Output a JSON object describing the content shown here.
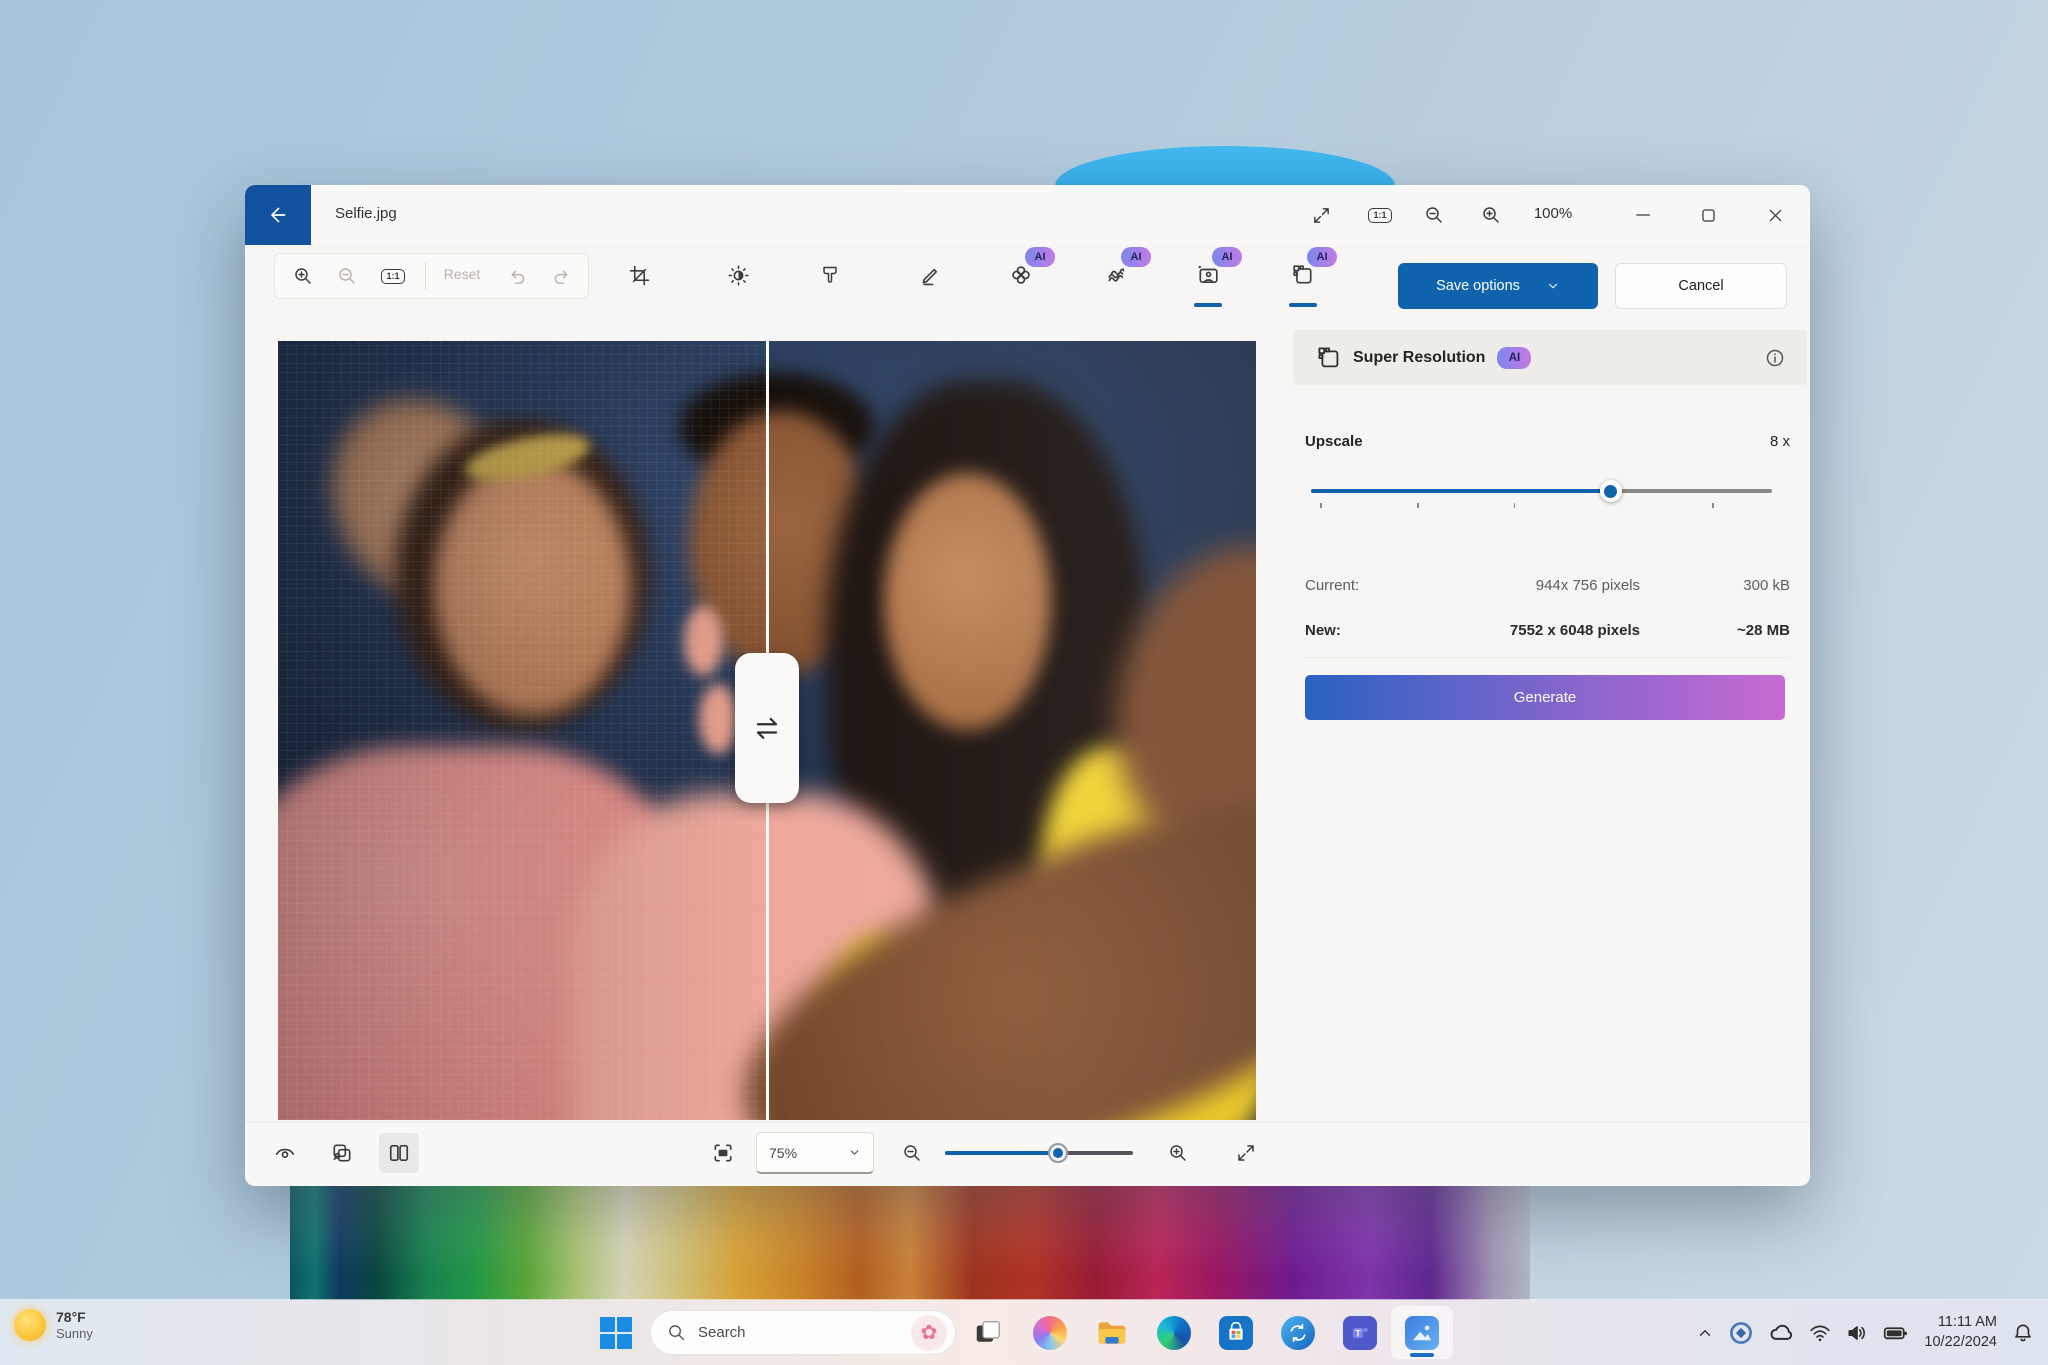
{
  "titlebar": {
    "title": "Selfie.jpg",
    "zoom_level": "100%",
    "actual_size": "1:1"
  },
  "toolbar": {
    "actual_size": "1:1",
    "reset": "Reset",
    "ai_badge": "AI",
    "save_options": "Save options",
    "cancel": "Cancel"
  },
  "panel": {
    "title": "Super Resolution",
    "ai_badge": "AI",
    "upscale_label": "Upscale",
    "upscale_value": "8 x",
    "current_label": "Current:",
    "current_pixels": "944x 756 pixels",
    "current_size": "300 kB",
    "new_label": "New:",
    "new_pixels": "7552 x 6048 pixels",
    "new_size": "~28 MB",
    "generate": "Generate"
  },
  "bottombar": {
    "zoom_value": "75%"
  },
  "taskbar": {
    "weather_temp": "78°F",
    "weather_condition": "Sunny",
    "search_placeholder": "Search",
    "time": "11:11 AM",
    "date": "10/22/2024"
  },
  "colors": {
    "accent": "#0F63AD",
    "back_button": "#11529F",
    "ai_badge_start": "#7B87EB",
    "ai_badge_end": "#C47AE3",
    "generate_start": "#2A62C1",
    "generate_end": "#C76BD2",
    "active_underline": "#1A6FC4"
  },
  "icons": [
    "back-arrow",
    "fullscreen",
    "actual-size",
    "zoom-out",
    "zoom-in",
    "minimize",
    "maximize",
    "close",
    "undo",
    "redo",
    "crop",
    "brightness",
    "filter",
    "markup-pen",
    "auto-enhance-ai",
    "generative-erase-ai",
    "background-ai",
    "super-resolution-ai",
    "chevron-down",
    "info",
    "swap",
    "eye-preview",
    "compare",
    "split-view",
    "fit-to-window",
    "expand",
    "windows-logo",
    "search",
    "task-view",
    "copilot",
    "file-explorer",
    "edge",
    "store",
    "sync",
    "teams",
    "photos",
    "chevron-up",
    "security",
    "onedrive-cloud",
    "wifi",
    "volume",
    "battery",
    "notification-bell",
    "sun-weather",
    "lotus-flower"
  ]
}
